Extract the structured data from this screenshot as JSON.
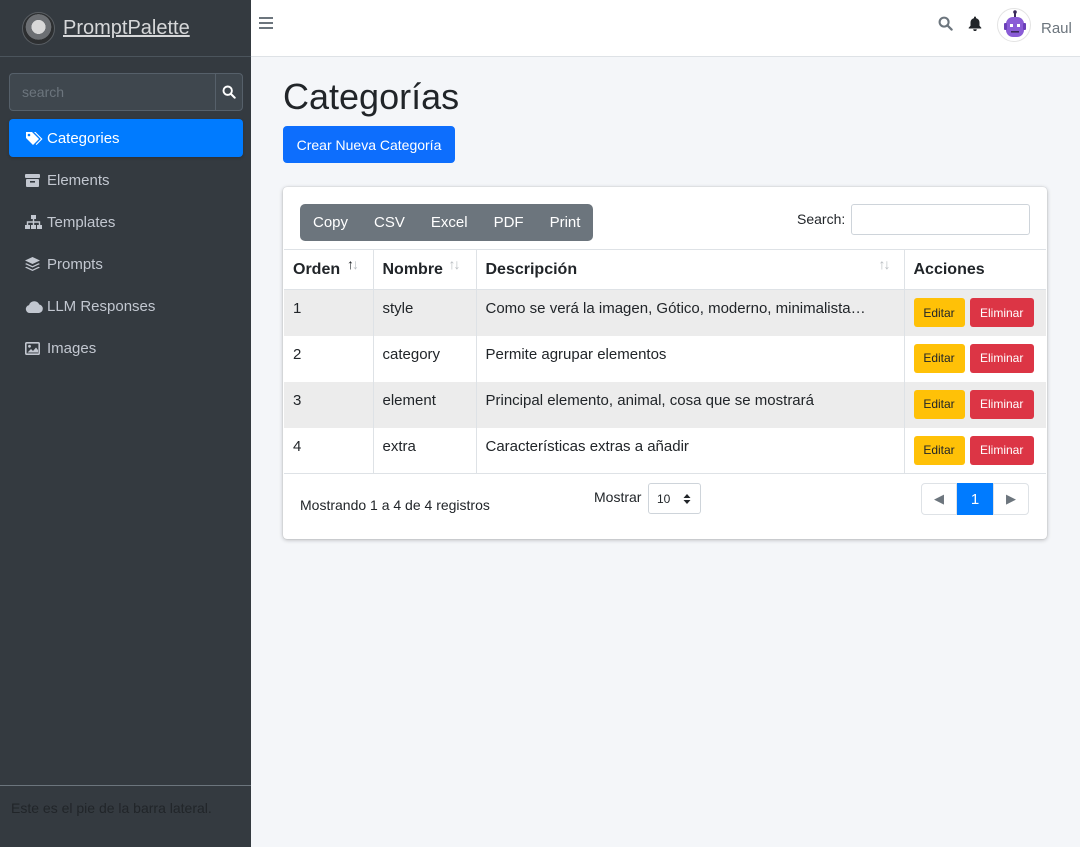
{
  "brand": {
    "name": "PromptPalette"
  },
  "sidebar": {
    "search_placeholder": "search",
    "items": [
      {
        "label": "Categories",
        "icon": "tags-icon",
        "active": true
      },
      {
        "label": "Elements",
        "icon": "boxes-icon",
        "active": false
      },
      {
        "label": "Templates",
        "icon": "sitemap-icon",
        "active": false
      },
      {
        "label": "Prompts",
        "icon": "layer-group-icon",
        "active": false
      },
      {
        "label": "LLM Responses",
        "icon": "cloud-icon",
        "active": false
      },
      {
        "label": "Images",
        "icon": "image-icon",
        "active": false
      }
    ],
    "footer": "Este es el pie de la barra lateral."
  },
  "topbar": {
    "username": "Raul"
  },
  "main": {
    "title": "Categorías",
    "create_button": "Crear Nueva Categoría"
  },
  "table": {
    "export_buttons": [
      "Copy",
      "CSV",
      "Excel",
      "PDF",
      "Print"
    ],
    "search_label": "Search:",
    "columns": [
      "Orden",
      "Nombre",
      "Descripción",
      "Acciones"
    ],
    "rows": [
      {
        "orden": "1",
        "nombre": "style",
        "descripcion": "Como se verá la imagen, Gótico, moderno, minimalista…"
      },
      {
        "orden": "2",
        "nombre": "category",
        "descripcion": "Permite agrupar elementos"
      },
      {
        "orden": "3",
        "nombre": "element",
        "descripcion": "Principal elemento, animal, cosa que se mostrará"
      },
      {
        "orden": "4",
        "nombre": "extra",
        "descripcion": "Características extras a añadir"
      }
    ],
    "edit_label": "Editar",
    "delete_label": "Eliminar",
    "info": "Mostrando 1 a 4 de 4 registros",
    "length_label": "Mostrar",
    "length_value": "10",
    "pager": {
      "prev": "◀",
      "current": "1",
      "next": "▶"
    }
  },
  "colors": {
    "sidebar_bg": "#343a40",
    "active": "#007bff",
    "primary": "#0d6efd",
    "warning": "#ffc107",
    "danger": "#dc3545",
    "secondary": "#6c757d"
  }
}
